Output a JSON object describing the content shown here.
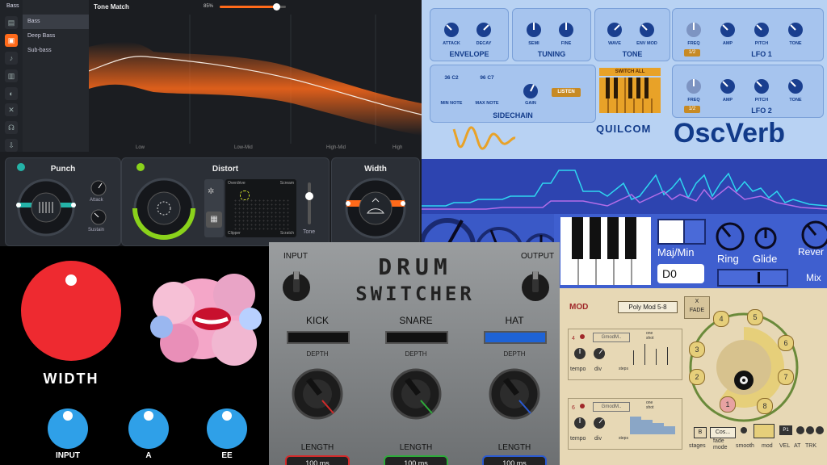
{
  "tone_match": {
    "sidebar_header": "Bass",
    "add_label": "+",
    "presets": [
      "Bass",
      "Deep Bass",
      "Sub-bass"
    ],
    "title": "Tone Match",
    "amount_label": "85%",
    "amount_value": 0.85,
    "bands": [
      "Low",
      "Low-Mid",
      "High-Mid",
      "High"
    ],
    "punch": {
      "title": "Punch",
      "attack": "Attack",
      "sustain": "Sustain"
    },
    "distort": {
      "title": "Distort",
      "overdrive": "Overdrive",
      "scream": "Scream",
      "clipper": "Clipper",
      "scratch": "Scratch",
      "tone": "Tone"
    },
    "width": {
      "title": "Width"
    },
    "colors": {
      "accent": "#ff6a1a",
      "green": "#8ad21b",
      "teal": "#24b3a8"
    }
  },
  "oscverb": {
    "envelope": {
      "title": "ENVELOPE",
      "knobs": [
        "ATTACK",
        "DECAY"
      ]
    },
    "tuning": {
      "title": "TUNING",
      "knobs": [
        "SEMI",
        "FINE"
      ]
    },
    "tone": {
      "title": "TONE",
      "knobs": [
        "WAVE",
        "ENV MOD"
      ]
    },
    "lfo1": {
      "title": "LFO 1",
      "knobs": [
        "FREQ",
        "AMP",
        "PITCH",
        "TONE"
      ],
      "badge": "1/2"
    },
    "sidechain": {
      "title": "SIDECHAIN",
      "min_note_value": "36  C2",
      "max_note_value": "96  C7",
      "min_note": "MIN NOTE",
      "max_note": "MAX NOTE",
      "gain": "GAIN",
      "listen": "LISTEN"
    },
    "switch_all": "SWITCH ALL",
    "lfo2": {
      "title": "LFO 2",
      "knobs": [
        "FREQ",
        "AMP",
        "PITCH",
        "TONE"
      ],
      "badge": "1/2"
    },
    "brand": "QUILCOM",
    "product": "OscVerb"
  },
  "synth_strip": {
    "maj_min": "Maj/Min",
    "note": "D0",
    "ring": "Ring",
    "glide": "Glide",
    "reverb": "Rever",
    "mix": "Mix"
  },
  "width_plugin": {
    "title": "WIDTH",
    "knobs": [
      "INPUT",
      "A",
      "EE"
    ],
    "colors": {
      "red": "#ee2a30",
      "blue": "#2fa0e8"
    }
  },
  "drum_switcher": {
    "title_line1": "DRUM",
    "title_line2": "SWITCHER",
    "input": "INPUT",
    "output": "OUTPUT",
    "channels": [
      {
        "name": "KICK",
        "depth": "DEPTH",
        "length": "LENGTH",
        "value": "100 ms",
        "color": "#d22a2a"
      },
      {
        "name": "SNARE",
        "depth": "DEPTH",
        "length": "LENGTH",
        "value": "100 ms",
        "color": "#2eaa3a"
      },
      {
        "name": "HAT",
        "depth": "DEPTH",
        "length": "LENGTH",
        "value": "100 ms",
        "color": "#2a5ad2"
      }
    ]
  },
  "mod_panel": {
    "mod": "MOD",
    "preset": "Poly Mod 5-8",
    "xfade": "X\nFADE",
    "steps": [
      "1",
      "2",
      "3",
      "4",
      "5",
      "6",
      "7",
      "8"
    ],
    "row1": {
      "num": "4",
      "name": "GmodM..",
      "opts": "one\nshot",
      "tempo": "tempo",
      "div": "div",
      "steps": "steps"
    },
    "row2": {
      "num": "6",
      "name": "GmodM..",
      "opts": "one\nshot",
      "tempo": "tempo",
      "div": "div",
      "steps": "steps"
    },
    "bottom": {
      "b": "B",
      "cos": "Cos...",
      "stages": "stages",
      "fade": "fade\nmode",
      "smooth": "smooth",
      "mod": "mod",
      "vel": "VEL",
      "at": "AT",
      "trk": "TRK",
      "p1": "P1"
    }
  }
}
